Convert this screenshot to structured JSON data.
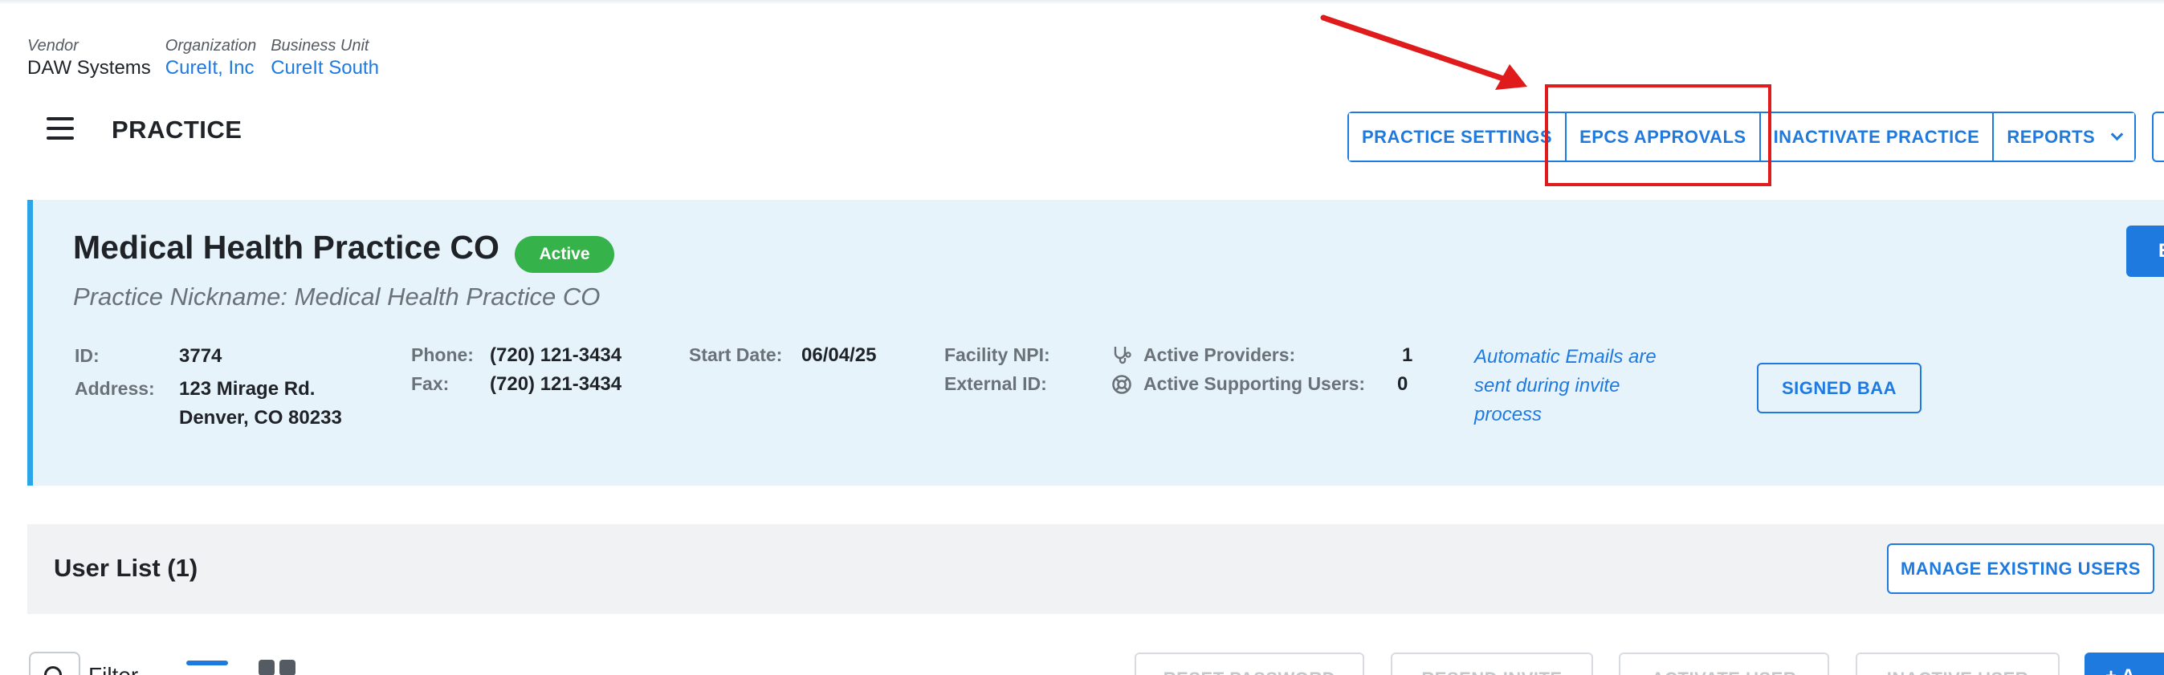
{
  "breadcrumb": {
    "vendor": {
      "label": "Vendor",
      "value": "DAW Systems"
    },
    "organization": {
      "label": "Organization",
      "value": "CureIt, Inc"
    },
    "business_unit": {
      "label": "Business Unit",
      "value": "CureIt South"
    }
  },
  "header": {
    "title": "PRACTICE",
    "buttons": {
      "practice_settings": "PRACTICE SETTINGS",
      "epcs_approvals": "EPCS APPROVALS",
      "inactivate_practice": "INACTIVATE PRACTICE",
      "reports": "REPORTS"
    }
  },
  "practice": {
    "name": "Medical Health Practice CO",
    "status": "Active",
    "nickname": "Practice Nickname: Medical Health Practice CO",
    "edit_label": "E",
    "id_label": "ID:",
    "id_value": "3774",
    "address_label": "Address:",
    "address_line1": "123 Mirage Rd.",
    "address_line2": "Denver, CO 80233",
    "phone_label": "Phone:",
    "phone_value": "(720) 121-3434",
    "fax_label": "Fax:",
    "fax_value": "(720) 121-3434",
    "start_date_label": "Start Date:",
    "start_date_value": "06/04/25",
    "facility_npi_label": "Facility NPI:",
    "external_id_label": "External ID:",
    "active_providers_label": "Active Providers:",
    "active_providers_value": "1",
    "active_supporting_label": "Active Supporting Users:",
    "active_supporting_value": "0",
    "auto_email_note": "Automatic Emails are sent during invite process",
    "signed_baa_label": "SIGNED BAA"
  },
  "user_list": {
    "title": "User List (1)",
    "manage_label": "MANAGE EXISTING USERS",
    "filter_label": "Filter",
    "toolbar": {
      "reset_password": "RESET PASSWORD",
      "resend_invite": "RESEND INVITE",
      "activate_user": "ACTIVATE USER",
      "inactive_user": "INACTIVE USER",
      "add": "+ A"
    }
  },
  "colors": {
    "accent": "#1f7ae0",
    "active_badge": "#36b24a",
    "panel_bg": "#e6f3fb",
    "annotation": "#e01b1b"
  },
  "icons": [
    "menu-icon",
    "stethoscope-icon",
    "lifebuoy-icon",
    "search-icon",
    "list-view-icon",
    "grid-view-icon",
    "chevron-down-icon",
    "annotation-arrow-icon"
  ]
}
